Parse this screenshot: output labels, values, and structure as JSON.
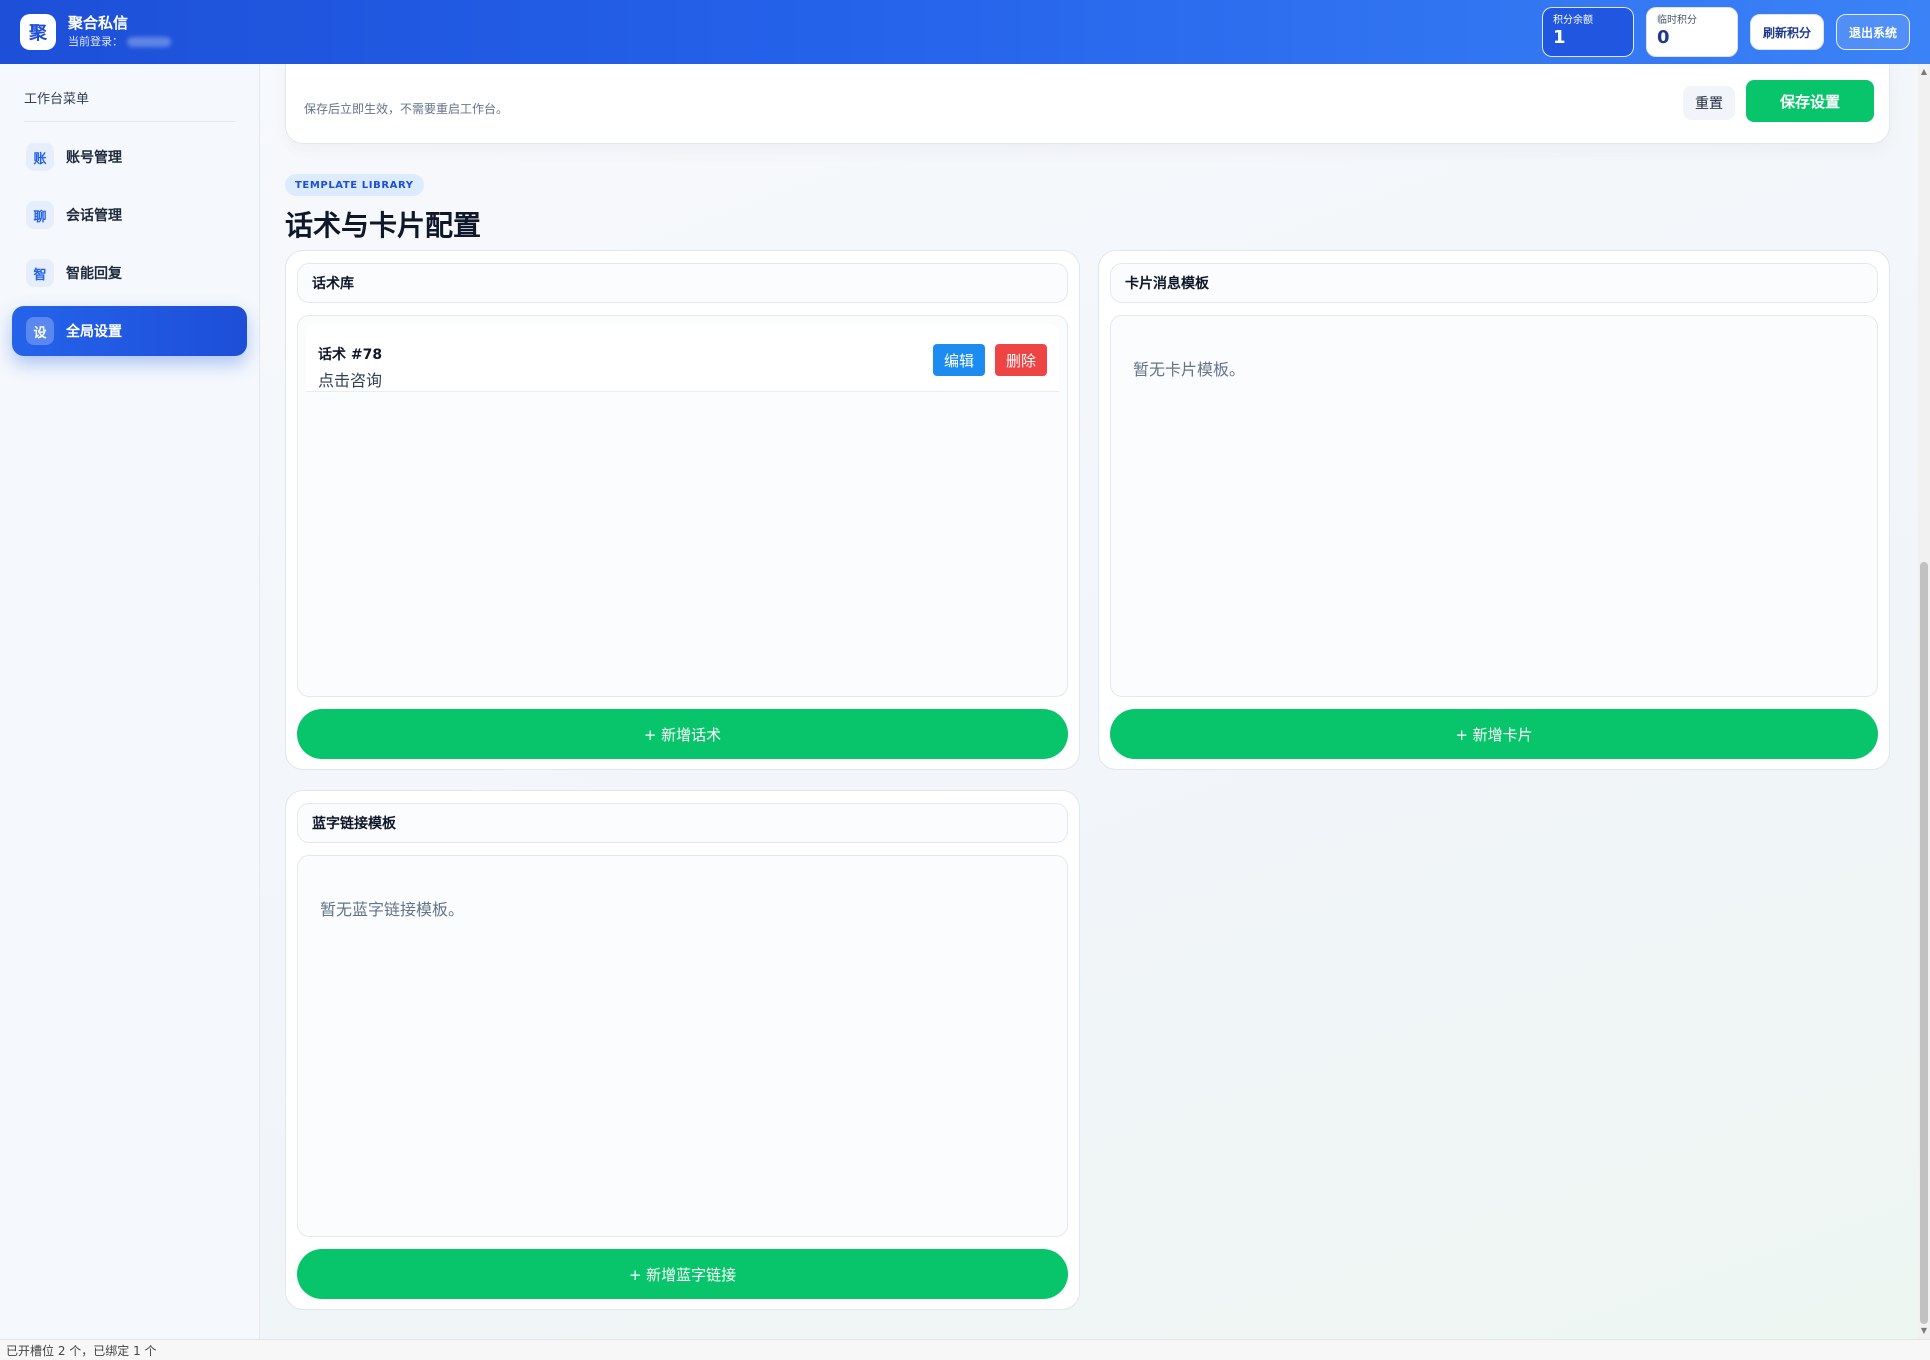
{
  "app": {
    "logo_char": "聚",
    "name": "聚合私信",
    "login_label": "当前登录："
  },
  "header": {
    "stats": [
      {
        "label": "积分余额",
        "value": "1"
      },
      {
        "label": "临时积分",
        "value": "0"
      }
    ],
    "refresh_label": "刷新积分",
    "logout_label": "退出系统"
  },
  "sidebar": {
    "title": "工作台菜单",
    "items": [
      {
        "icon": "账",
        "label": "账号管理",
        "active": false
      },
      {
        "icon": "聊",
        "label": "会话管理",
        "active": false
      },
      {
        "icon": "智",
        "label": "智能回复",
        "active": false
      },
      {
        "icon": "设",
        "label": "全局设置",
        "active": true
      }
    ]
  },
  "settings": {
    "hint": "保存后立即生效，不需要重启工作台。",
    "reset_label": "重置",
    "save_label": "保存设置"
  },
  "section": {
    "tag": "TEMPLATE LIBRARY",
    "title": "话术与卡片配置"
  },
  "panels": {
    "scripts": {
      "title": "话术库",
      "items": [
        {
          "title": "话术 #78",
          "text": "点击咨询",
          "edit_label": "编辑",
          "delete_label": "删除"
        }
      ],
      "add_label": "+ 新增话术"
    },
    "cards": {
      "title": "卡片消息模板",
      "empty_text": "暂无卡片模板。",
      "add_label": "+ 新增卡片"
    },
    "links": {
      "title": "蓝字链接模板",
      "empty_text": "暂无蓝字链接模板。",
      "add_label": "+ 新增蓝字链接"
    }
  },
  "statusbar": {
    "text": "已开槽位 2 个，已绑定 1 个"
  },
  "colors": {
    "header_gradient_start": "#1d4fd8",
    "header_gradient_end": "#3b82f6",
    "accent_green": "#08c46a",
    "edit_blue": "#1d8cf0",
    "delete_red": "#ef4444",
    "active_nav": "#2563eb"
  }
}
